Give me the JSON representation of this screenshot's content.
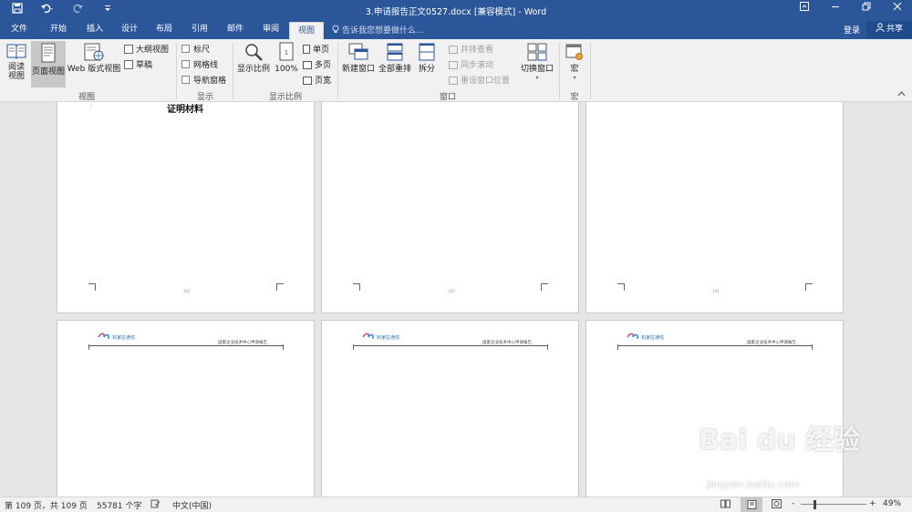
{
  "app": {
    "document_title": "3.申请报告正文0527.docx [兼容模式] - Word"
  },
  "tabs": [
    {
      "label": "文件"
    },
    {
      "label": "开始"
    },
    {
      "label": "插入"
    },
    {
      "label": "设计"
    },
    {
      "label": "布局"
    },
    {
      "label": "引用"
    },
    {
      "label": "邮件"
    },
    {
      "label": "审阅"
    },
    {
      "label": "视图",
      "active": true
    }
  ],
  "tell_me": "告诉我您想要做什么...",
  "account": {
    "signin": "登录",
    "share": "共享"
  },
  "ribbon": {
    "views": {
      "read_mode": "阅读\n视图",
      "read_mode_l1": "阅读",
      "read_mode_l2": "视图",
      "print_layout": "页面视图",
      "web_layout": "Web 版式视图",
      "outline": "大纲视图",
      "draft": "草稿",
      "group": "视图"
    },
    "show": {
      "ruler": "标尺",
      "gridlines": "网格线",
      "nav_pane": "导航窗格",
      "group": "显示"
    },
    "zoom": {
      "zoom": "显示比例",
      "hundred": "100%",
      "one_page": "单页",
      "multi_page": "多页",
      "page_width": "页宽",
      "group": "显示比例"
    },
    "window": {
      "new_window": "新建窗口",
      "arrange_all": "全部重排",
      "split": "拆分",
      "side_by_side": "并排查看",
      "sync_scroll": "同步滚动",
      "reset_pos": "重设窗口位置",
      "switch": "切换窗口",
      "group": "窗口"
    },
    "macros": {
      "macros": "宏",
      "group": "宏"
    }
  },
  "pages": {
    "top_heading": "证明材料",
    "header_logo": "石家庄通信",
    "header_right": "国家企业技术中心申请报告",
    "page_numbers": [
      "102",
      "103",
      "104"
    ]
  },
  "statusbar": {
    "page_info": "第 109 页，共 109 页",
    "word_count": "55781 个字",
    "language": "中文(中国)",
    "zoom_minus": "-",
    "zoom_plus": "+",
    "zoom_level": "49%"
  },
  "watermark": {
    "brand": "Bai du 经验",
    "url": "jingyan.baidu.com"
  },
  "colors": {
    "title_blue": "#2b579a",
    "ribbon_bg": "#f1f1f1",
    "doc_bg": "#e6e6e6"
  }
}
